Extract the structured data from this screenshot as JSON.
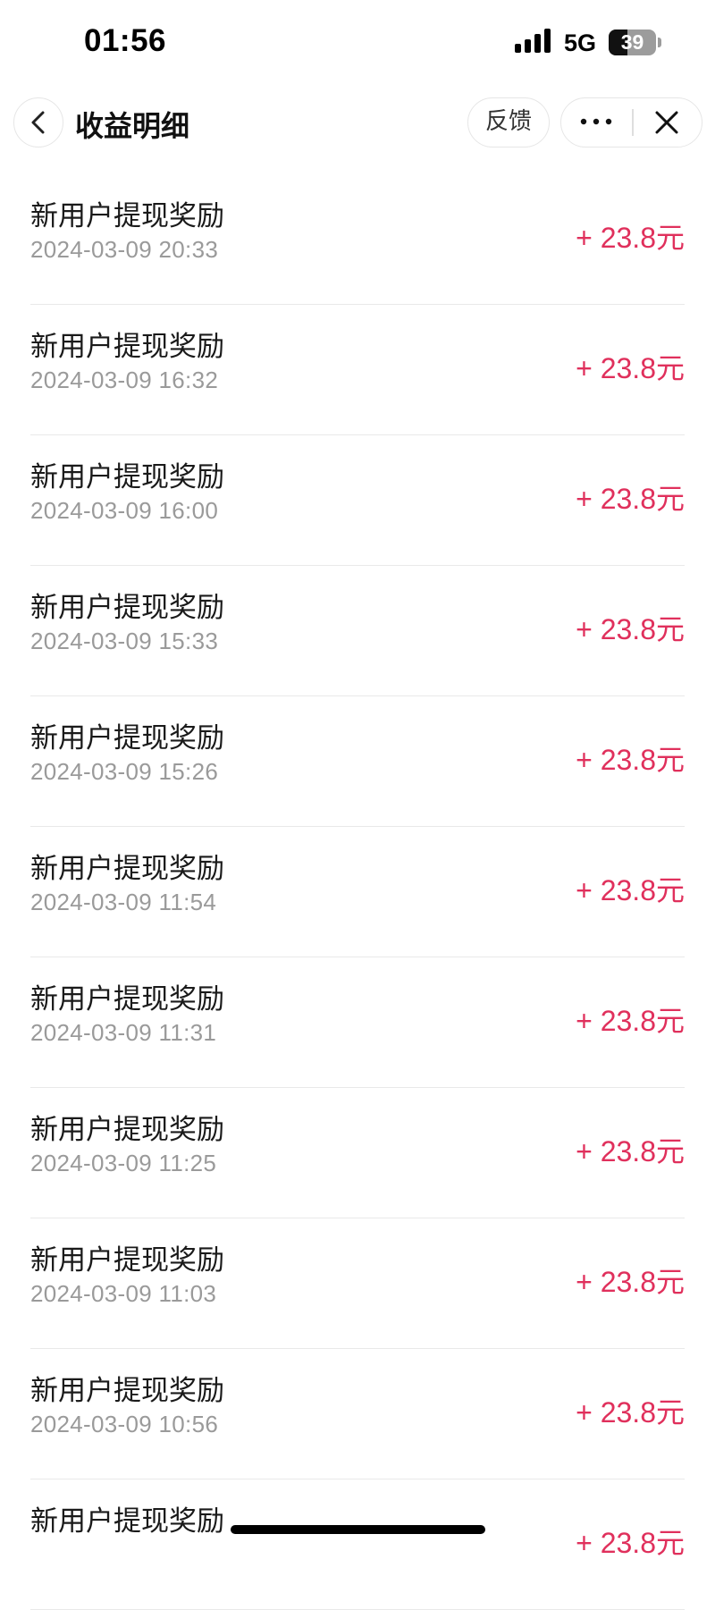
{
  "status_bar": {
    "time": "01:56",
    "network": "5G",
    "battery_level": "39",
    "battery_fraction": 0.39
  },
  "nav": {
    "back_icon": "chevron-left-icon",
    "title": "收益明细",
    "feedback_label": "反馈",
    "more_icon": "more-dots-icon",
    "close_icon": "close-icon"
  },
  "colors": {
    "amount": "#e0305c",
    "title_text": "#1a1a1a",
    "time_text": "#9a9a9a"
  },
  "records": [
    {
      "title": "新用户提现奖励",
      "time": "2024-03-09 20:33",
      "amount": "+ 23.8元"
    },
    {
      "title": "新用户提现奖励",
      "time": "2024-03-09 16:32",
      "amount": "+ 23.8元"
    },
    {
      "title": "新用户提现奖励",
      "time": "2024-03-09 16:00",
      "amount": "+ 23.8元"
    },
    {
      "title": "新用户提现奖励",
      "time": "2024-03-09 15:33",
      "amount": "+ 23.8元"
    },
    {
      "title": "新用户提现奖励",
      "time": "2024-03-09 15:26",
      "amount": "+ 23.8元"
    },
    {
      "title": "新用户提现奖励",
      "time": "2024-03-09 11:54",
      "amount": "+ 23.8元"
    },
    {
      "title": "新用户提现奖励",
      "time": "2024-03-09 11:31",
      "amount": "+ 23.8元"
    },
    {
      "title": "新用户提现奖励",
      "time": "2024-03-09 11:25",
      "amount": "+ 23.8元"
    },
    {
      "title": "新用户提现奖励",
      "time": "2024-03-09 11:03",
      "amount": "+ 23.8元"
    },
    {
      "title": "新用户提现奖励",
      "time": "2024-03-09 10:56",
      "amount": "+ 23.8元"
    },
    {
      "title": "新用户提现奖励",
      "time": "",
      "amount": "+ 23.8元"
    }
  ]
}
